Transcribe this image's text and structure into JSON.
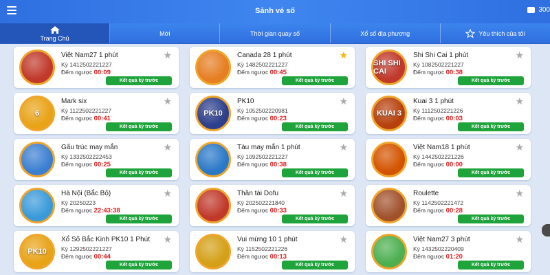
{
  "header": {
    "title": "Sảnh vé số",
    "balance": "300"
  },
  "tabs": [
    {
      "label": "Trang Chủ",
      "icon": "home-icon"
    },
    {
      "label": "Mới"
    },
    {
      "label": "Thời gian quay số"
    },
    {
      "label": "Xổ số địa phương"
    },
    {
      "label": "Yêu thích của tôi",
      "icon": "star-outline-icon"
    }
  ],
  "labels": {
    "period_prefix": "Kỳ",
    "countdown_prefix": "Đếm ngược",
    "prev_results_button": "Kết quả kỳ trước"
  },
  "games": [
    {
      "name": "Việt Nam27 1 phút",
      "period": "1412502221227",
      "countdown": "00:09",
      "favorite": false,
      "icon_text": "",
      "icon_color": "#c0392b"
    },
    {
      "name": "Canada 28 1 phút",
      "period": "1482502221227",
      "countdown": "00:45",
      "favorite": true,
      "icon_text": "",
      "icon_color": "#e67e22"
    },
    {
      "name": "Shi Shi Cai 1 phút",
      "period": "1082502221227",
      "countdown": "00:38",
      "favorite": false,
      "icon_text": "SHI SHI CAI",
      "icon_color": "#c0392b"
    },
    {
      "name": "Mark six",
      "period": "1122502221227",
      "countdown": "00:41",
      "favorite": false,
      "icon_text": "6",
      "icon_color": "#e8a317"
    },
    {
      "name": "PK10",
      "period": "1052502220981",
      "countdown": "00:23",
      "favorite": false,
      "icon_text": "PK10",
      "icon_color": "#2c3e8c"
    },
    {
      "name": "Kuai 3 1 phút",
      "period": "1112502221226",
      "countdown": "00:03",
      "favorite": false,
      "icon_text": "KUAI 3",
      "icon_color": "#b7410e"
    },
    {
      "name": "Gấu trúc may mắn",
      "period": "1332502222453",
      "countdown": "00:25",
      "favorite": false,
      "icon_text": "",
      "icon_color": "#3c7fd1"
    },
    {
      "name": "Tàu may mắn 1 phút",
      "period": "1092502221227",
      "countdown": "00:38",
      "favorite": false,
      "icon_text": "",
      "icon_color": "#2a78c8"
    },
    {
      "name": "Việt Nam18 1 phút",
      "period": "1442502221226",
      "countdown": "00:00",
      "favorite": false,
      "icon_text": "",
      "icon_color": "#d35400"
    },
    {
      "name": "Hà Nội (Bắc Bộ)",
      "period": "20250223",
      "countdown": "22:43:38",
      "favorite": false,
      "icon_text": "",
      "icon_color": "#3a9ad9"
    },
    {
      "name": "Thần tài Dofu",
      "period": "202502221840",
      "countdown": "00:33",
      "favorite": false,
      "icon_text": "",
      "icon_color": "#c0392b"
    },
    {
      "name": "Roulette",
      "period": "1142502221472",
      "countdown": "00:28",
      "favorite": false,
      "icon_text": "",
      "icon_color": "#a0522d"
    },
    {
      "name": "Xổ Số Bắc Kinh PK10 1 Phút",
      "period": "1292502221227",
      "countdown": "00:44",
      "favorite": false,
      "icon_text": "PK10",
      "icon_color": "#e8a317"
    },
    {
      "name": "Vui mừng 10 1 phút",
      "period": "1152502221226",
      "countdown": "00:13",
      "favorite": false,
      "icon_text": "",
      "icon_color": "#d4a017"
    },
    {
      "name": "Việt Nam27 3 phút",
      "period": "1432502220409",
      "countdown": "01:20",
      "favorite": false,
      "icon_text": "",
      "icon_color": "#4caf50"
    }
  ]
}
